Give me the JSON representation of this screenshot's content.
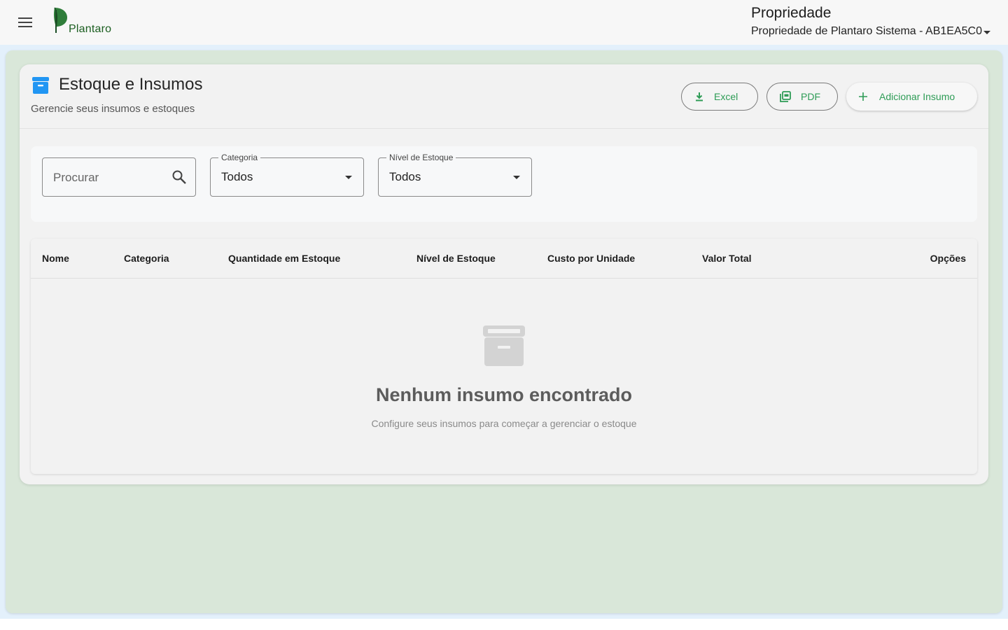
{
  "app": {
    "logo_text": "Plantaro"
  },
  "header": {
    "property_title": "Propriedade",
    "property_selected": "Propriedade de Plantaro Sistema - AB1EA5C0"
  },
  "page": {
    "title": "Estoque e Insumos",
    "subtitle": "Gerencie seus insumos e estoques",
    "buttons": {
      "excel": "Excel",
      "pdf": "PDF",
      "add": "Adicionar Insumo"
    }
  },
  "filters": {
    "search": {
      "placeholder": "Procurar",
      "value": ""
    },
    "category": {
      "label": "Categoria",
      "value": "Todos"
    },
    "stock_level": {
      "label": "Nível de Estoque",
      "value": "Todos"
    }
  },
  "table": {
    "columns": [
      "Nome",
      "Categoria",
      "Quantidade em Estoque",
      "Nível de Estoque",
      "Custo por Unidade",
      "Valor Total",
      "Opções"
    ],
    "rows": []
  },
  "empty_state": {
    "title": "Nenhum insumo encontrado",
    "subtitle": "Configure seus insumos para começar a gerenciar o estoque",
    "icon": "archive-icon"
  },
  "colors": {
    "accent_green": "#2e9c56",
    "logo_green": "#1b5e20",
    "header_icon_blue": "#2196f3",
    "shell_bg": "#d9e7d9"
  }
}
